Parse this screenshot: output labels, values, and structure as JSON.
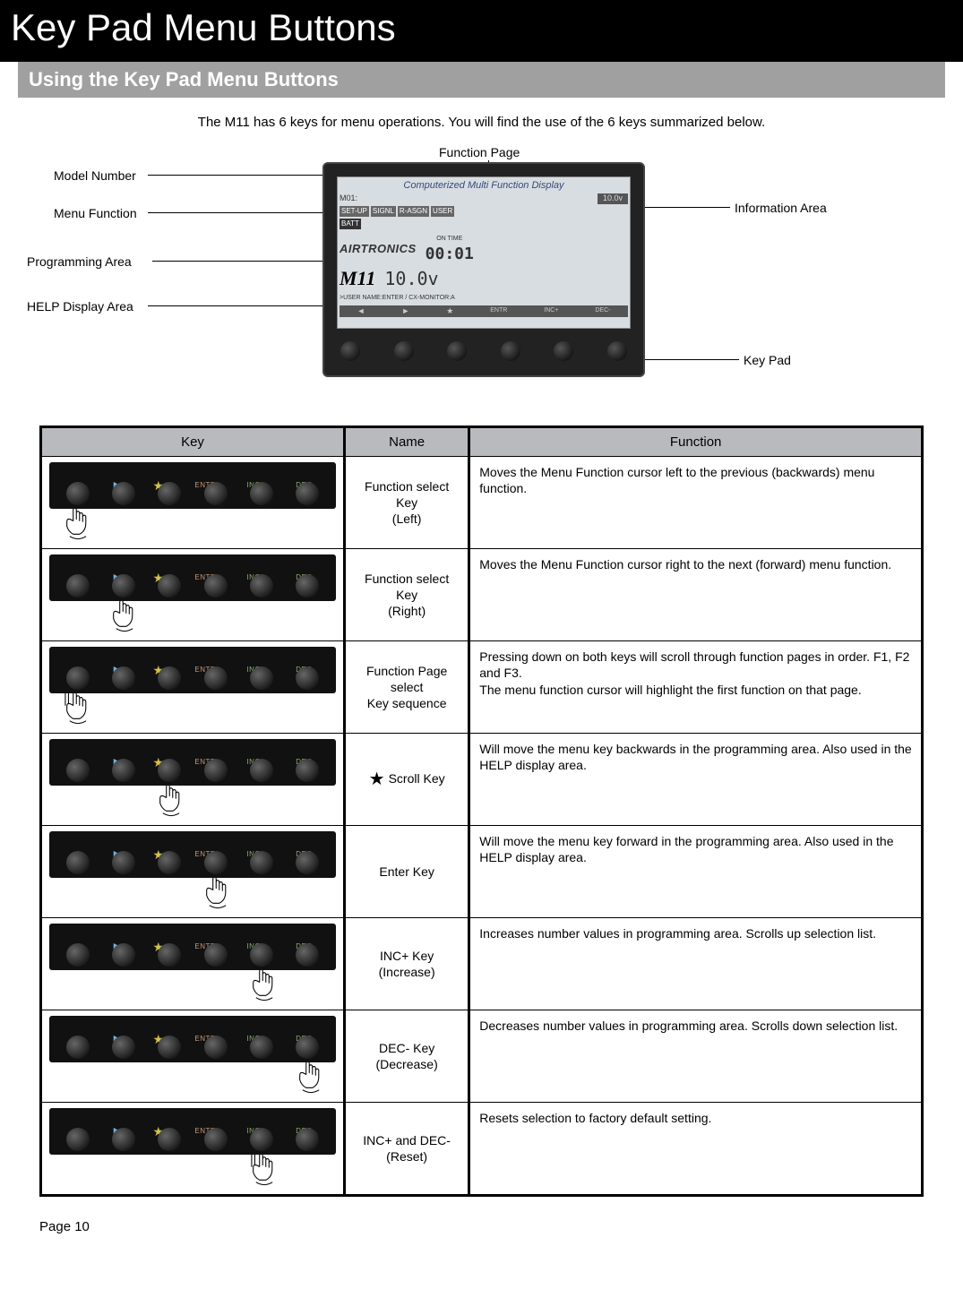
{
  "page": {
    "title": "Key Pad Menu Buttons",
    "section": "Using the Key Pad Menu Buttons",
    "intro": "The M11 has 6 keys for menu operations.  You will find the use of the 6 keys summarized below.",
    "footer_page": "Page 10"
  },
  "diagram": {
    "labels": {
      "function_page": "Function Page",
      "model_number": "Model Number",
      "menu_function": "Menu Function",
      "programming_area": "Programming Area",
      "help_display_area": "HELP Display Area",
      "information_area": "Information Area",
      "key_pad": "Key Pad"
    },
    "screen": {
      "banner": "Computerized Multi Function Display",
      "model": "M01:",
      "vbat": "10.0v",
      "tabs": [
        "SET-UP",
        "SIGNL",
        "R-ASGN",
        "USER"
      ],
      "batt": "BATT",
      "brand": "AIRTRONICS",
      "timer_label": "ON TIME",
      "timer": "00:01",
      "big_model": "M11",
      "big_volt": "10.0v",
      "help": ">USER NAME:ENTER / CX-MONITOR:A"
    }
  },
  "table": {
    "headers": {
      "key": "Key",
      "name": "Name",
      "function": "Function"
    },
    "rows": [
      {
        "name": "Function select Key\n(Left)",
        "func": "Moves the Menu Function cursor left to the previous (backwards) menu function."
      },
      {
        "name": "Function select Key\n(Right)",
        "func": "Moves the Menu Function cursor right to the next (forward) menu function."
      },
      {
        "name": "Function Page select\nKey sequence",
        "func": "Pressing down on both keys will scroll through function pages in order. F1, F2 and F3.\nThe menu function cursor will highlight the first function on that page."
      },
      {
        "name": "Scroll Key",
        "star": true,
        "func": "Will move the menu key backwards in the programming area. Also used in the HELP display area."
      },
      {
        "name": "Enter Key",
        "func": "Will move the menu key forward in the programming area. Also used in the HELP display area."
      },
      {
        "name": "INC+ Key\n(Increase)",
        "func": "Increases number values in programming area. Scrolls up selection list."
      },
      {
        "name": "DEC- Key\n(Decrease)",
        "func": "Decreases number values in programming area. Scrolls down selection list."
      },
      {
        "name": "INC+ and DEC-\n(Reset)",
        "func": "Resets selection to factory default setting."
      }
    ]
  }
}
